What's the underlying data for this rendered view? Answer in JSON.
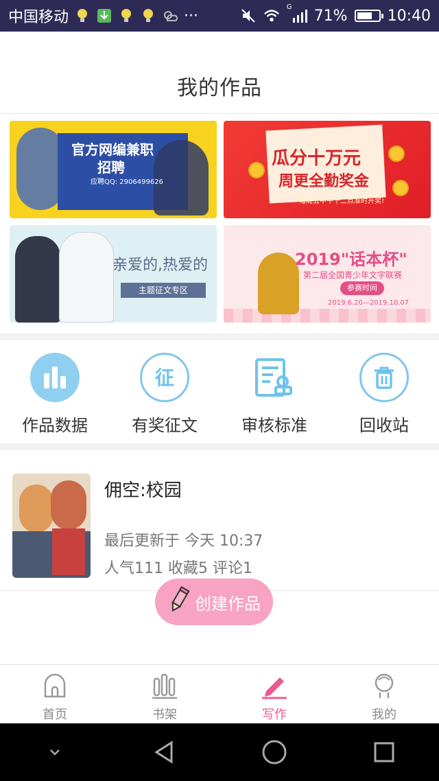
{
  "status_bar": {
    "carrier": "中国移动",
    "dots": "···",
    "signal_label": "G",
    "battery_percent": "71%",
    "battery_level": 0.71,
    "time": "10:40"
  },
  "header": {
    "title": "我的作品"
  },
  "banners": [
    {
      "line1": "官方网编兼职",
      "line2": "招聘",
      "line3": "应聘QQ: 2906499626"
    },
    {
      "line1": "瓜分十万元",
      "line2": "周更全勤奖金",
      "line3": "每周五中午十二点准时开奖!"
    },
    {
      "line1": "亲爱的,热爱的",
      "badge": "主题征文专区"
    },
    {
      "line1": "2019\"话本杯\"",
      "line2": "第二届全国青少年文字联赛",
      "pill": "参赛时间",
      "line3": "2019.6.20—2019.10.07"
    }
  ],
  "actions": [
    {
      "label": "作品数据",
      "icon": "bar-chart-icon"
    },
    {
      "label": "有奖征文",
      "icon": "contest-icon"
    },
    {
      "label": "审核标准",
      "icon": "review-standard-icon"
    },
    {
      "label": "回收站",
      "icon": "trash-icon"
    }
  ],
  "work": {
    "title": "佣空:校园",
    "updated": "最后更新于 今天 10:37",
    "stats": "人气111 收藏5 评论1"
  },
  "create_button": {
    "label": "创建作品",
    "icon": "pencil-icon"
  },
  "tabs": [
    {
      "label": "首页",
      "icon": "home-icon",
      "active": false
    },
    {
      "label": "书架",
      "icon": "bookshelf-icon",
      "active": false
    },
    {
      "label": "写作",
      "icon": "write-icon",
      "active": true
    },
    {
      "label": "我的",
      "icon": "profile-icon",
      "active": false
    }
  ],
  "colors": {
    "status_bar": "#2d2b55",
    "accent_pink": "#ec5a93",
    "create_button": "#f7a3c1",
    "action_blue": "#6ec3ec"
  }
}
